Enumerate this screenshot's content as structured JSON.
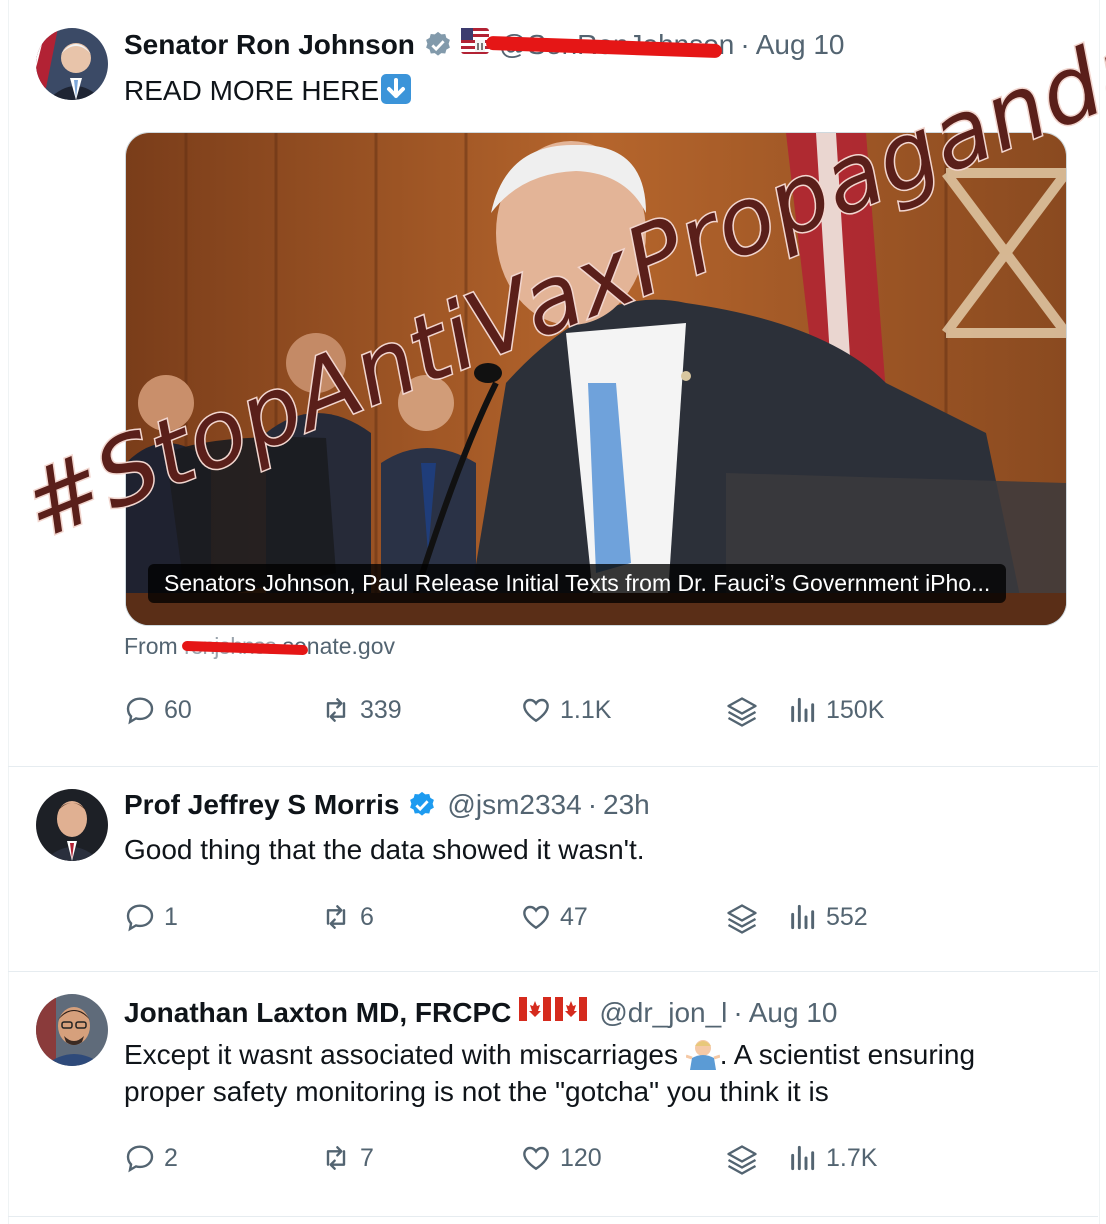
{
  "colors": {
    "text": "#0f1419",
    "muted": "#536471",
    "verified_blue": "#1d9bf0",
    "verified_gray": "#829aab",
    "overlay_fill": "#5a1f1a",
    "overlay_stroke": "#f2d6cf",
    "redaction": "#e51616"
  },
  "overlay_text": "#StopAntiVaxPropaganda",
  "tweets": [
    {
      "name": "Senator Ron Johnson",
      "badge": "gray-verified-icon",
      "flag": "us-capitol-flag-icon",
      "handle": "@SenRonJohnson",
      "sep": "·",
      "time": "Aug 10",
      "text": "READ MORE HERE",
      "emoji": "⬇",
      "card": {
        "caption": "Senators Johnson, Paul Release Initial Texts from Dr. Fauci’s Government iPho...",
        "from_label": "From",
        "domain": "ronjohnson.senate.gov",
        "domain_visible": ".senate.gov"
      },
      "stats": {
        "replies": "60",
        "reposts": "339",
        "likes": "1.1K",
        "views": "150K"
      }
    },
    {
      "name": "Prof Jeffrey S Morris",
      "badge": "blue-verified-icon",
      "handle": "@jsm2334",
      "sep": "·",
      "time": "23h",
      "text": "Good thing that the data showed it wasn't.",
      "stats": {
        "replies": "1",
        "reposts": "6",
        "likes": "47",
        "views": "552"
      }
    },
    {
      "name": "Jonathan Laxton MD, FRCPC",
      "flags": "🇨🇦🇨🇦",
      "handle": "@dr_jon_l",
      "sep": "·",
      "time": "Aug 10",
      "text_line1": "Except it wasnt associated with miscarriages",
      "emoji": "🤷‍♂️",
      "text_line1b": ".  A scientist ensuring",
      "text_line2": "proper safety monitoring is not the \"gotcha\" you think it is",
      "stats": {
        "replies": "2",
        "reposts": "7",
        "likes": "120",
        "views": "1.7K"
      }
    }
  ]
}
